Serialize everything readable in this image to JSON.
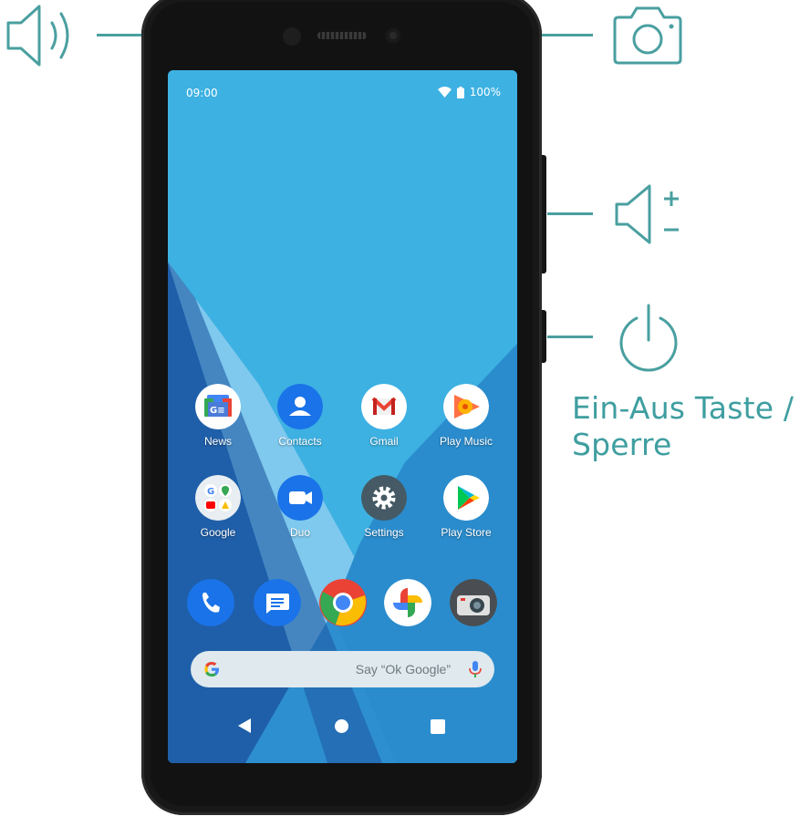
{
  "callouts": {
    "earpiece_speaker": {
      "icon": "speaker-icon"
    },
    "front_camera": {
      "icon": "camera-icon"
    },
    "volume_buttons": {
      "icon": "volume-plus-minus-icon"
    },
    "power_button": {
      "icon": "power-icon",
      "caption_line1": "Ein-Aus Taste /",
      "caption_line2": "Sperre"
    }
  },
  "colors": {
    "callout_accent": "#4a9fa0",
    "wallpaper_light": "#3fb4e3",
    "wallpaper_dark": "#1e5ea8"
  },
  "status_bar": {
    "time": "09:00",
    "battery": "100%",
    "icons": [
      "wifi-icon",
      "battery-icon"
    ]
  },
  "home_screen": {
    "apps_row1": [
      {
        "label": "News",
        "icon": "google-news-icon"
      },
      {
        "label": "Contacts",
        "icon": "contacts-icon"
      },
      {
        "label": "Gmail",
        "icon": "gmail-icon"
      },
      {
        "label": "Play Music",
        "icon": "play-music-icon"
      }
    ],
    "apps_row2": [
      {
        "label": "Google",
        "icon": "google-folder-icon"
      },
      {
        "label": "Duo",
        "icon": "duo-icon"
      },
      {
        "label": "Settings",
        "icon": "settings-icon"
      },
      {
        "label": "Play Store",
        "icon": "play-store-icon"
      }
    ],
    "dock": [
      "phone-icon",
      "messages-icon",
      "chrome-icon",
      "photos-icon",
      "camera-app-icon"
    ]
  },
  "search": {
    "placeholder": "Say “Ok Google”"
  },
  "navigation": [
    "back-button",
    "home-button",
    "recents-button"
  ]
}
